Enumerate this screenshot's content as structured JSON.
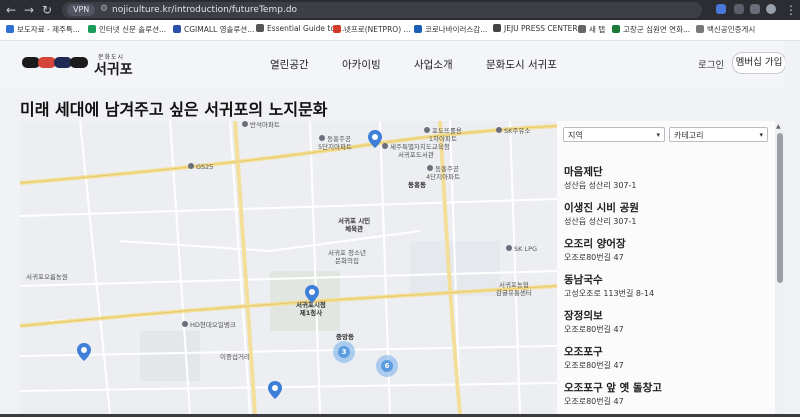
{
  "browser": {
    "url_chip": "VPN",
    "url": "nojiculture.kr/introduction/futureTemp.do",
    "bookmarks": [
      {
        "label": "보도자료 - 제주특...",
        "color": "#2f6fd6"
      },
      {
        "label": "인터넷 신문 솔루션...",
        "color": "#1a9b5a"
      },
      {
        "label": "CGIMALL 영솔루션...",
        "color": "#2a4fa8"
      },
      {
        "label": "Essential Guide to I...",
        "color": "#555555"
      },
      {
        "label": "넷프로(NETPRO) ...",
        "color": "#d23a2a"
      },
      {
        "label": "코로나바이러스감...",
        "color": "#1b5eb8"
      },
      {
        "label": "JEJU PRESS CENTER",
        "color": "#444444"
      },
      {
        "label": "새 탭",
        "color": "#666666"
      },
      {
        "label": "고창군 심원면 연화...",
        "color": "#1a7a3a"
      },
      {
        "label": "백신공인증게시",
        "color": "#777777"
      }
    ]
  },
  "site": {
    "logo_small": "문화도시",
    "logo_text": "서귀포",
    "colors": {
      "logo_red": "#d6453a",
      "logo_navy": "#1f2a55",
      "logo_black": "#1b1b1b",
      "pin": "#3d7fd9"
    },
    "nav": [
      "열린공간",
      "아카이빙",
      "사업소개",
      "문화도시 서귀포"
    ],
    "login": "로그인",
    "join": "멤버십 가입"
  },
  "page": {
    "title": "미래 세대에 남겨주고 싶은 서귀포의 노지문화"
  },
  "map": {
    "labels": [
      {
        "text": "반석아파트",
        "poi": true
      },
      {
        "text": "동홍주공\n5단지아파트",
        "poi": true
      },
      {
        "text": "세주특별자치도교육청\n서귀포도서관",
        "poi": true
      },
      {
        "text": "포도뜨롤용\n1차아파트",
        "poi": true
      },
      {
        "text": "동홍주공\n4단지아파트",
        "poi": true
      },
      {
        "text": "서귀포 시민\n체육관",
        "poi": false
      },
      {
        "text": "SK주유소",
        "poi": true
      },
      {
        "text": "서귀포오름농원",
        "poi": false
      },
      {
        "text": "서귀포 청소년\n문화의집",
        "poi": false
      },
      {
        "text": "서귀포시청\n제1청사",
        "poi": false
      },
      {
        "text": "중앙동",
        "poi": false
      },
      {
        "text": "이중섭거리",
        "poi": false
      },
      {
        "text": "동홍동",
        "poi": false
      },
      {
        "text": "GS25",
        "poi": true
      },
      {
        "text": "HD현대오일뱅크",
        "poi": true
      },
      {
        "text": "SK LPG",
        "poi": true
      },
      {
        "text": "서귀포농협\n감귤유통센터",
        "poi": false
      }
    ],
    "clusters": [
      "3",
      "6"
    ]
  },
  "panel": {
    "filter_region": "지역",
    "filter_category": "카테고리",
    "items": [
      {
        "name": "마음제단",
        "address": "성산읍 성산리 307-1"
      },
      {
        "name": "이생진 시비 공원",
        "address": "성산읍 성산리 307-1"
      },
      {
        "name": "오조리 양어장",
        "address": "오조로80번길 47"
      },
      {
        "name": "동남국수",
        "address": "고성오조로 113번길 8-14"
      },
      {
        "name": "장정의보",
        "address": "오조로80번길 47"
      },
      {
        "name": "오조포구",
        "address": "오조로80번길 47"
      },
      {
        "name": "오조포구 앞 옛 돌창고",
        "address": "오조로80번길 47"
      }
    ]
  }
}
